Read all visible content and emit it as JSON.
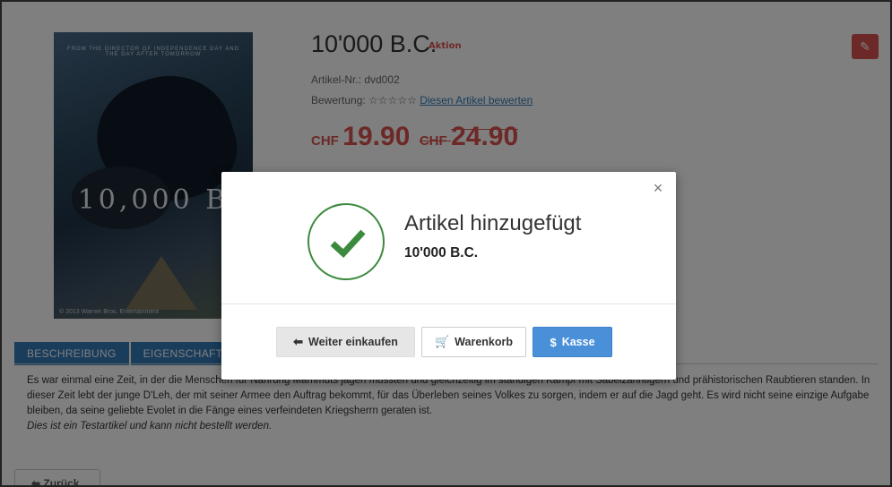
{
  "product": {
    "title": "10'000 B.C.",
    "badge": "Aktion",
    "article_number": "Artikel-Nr.: dvd002",
    "rating_label": "Bewertung:",
    "rating_stars": "☆☆☆☆☆",
    "rate_link": "Diesen Artikel bewerten",
    "currency": "CHF",
    "price": "19.90",
    "old_price": "24.90"
  },
  "poster": {
    "tagline": "FROM THE DIRECTOR OF INDEPENDENCE DAY AND THE DAY AFTER TOMORROW",
    "title": "10,000 B",
    "copyright": "© 2013 Warner Bros. Entertainment"
  },
  "tabs": [
    {
      "label": "BESCHREIBUNG"
    },
    {
      "label": "EIGENSCHAFTEN"
    }
  ],
  "description": {
    "text": "Es war einmal eine Zeit, in der die Menschen für Nahrung Mammuts jagen mussten und gleichzeitig im ständigen Kampf mit Säbelzahntigern und prähistorischen Raubtieren standen. In dieser Zeit lebt der junge D'Leh, der mit seiner Armee den Auftrag bekommt, für das Überleben seines Volkes zu sorgen, indem er auf die Jagd geht. Es wird nicht seine einzige Aufgabe bleiben, da seine geliebte Evolet in die Fänge eines verfeindeten Kriegsherrn geraten ist.",
    "note": "Dies ist ein Testartikel und kann nicht bestellt werden."
  },
  "back_button": "Zurück",
  "modal": {
    "heading": "Artikel hinzugefügt",
    "product": "10'000 B.C.",
    "close": "×",
    "buttons": {
      "continue": "Weiter einkaufen",
      "cart": "Warenkorb",
      "checkout": "Kasse"
    }
  },
  "colors": {
    "accent": "#4a90d9",
    "success": "#3c8a3e",
    "danger": "#d9534f"
  },
  "icons": [
    "pencil-icon",
    "arrow-left-icon",
    "cart-icon",
    "dollar-circle-icon",
    "check-icon",
    "close-icon"
  ]
}
